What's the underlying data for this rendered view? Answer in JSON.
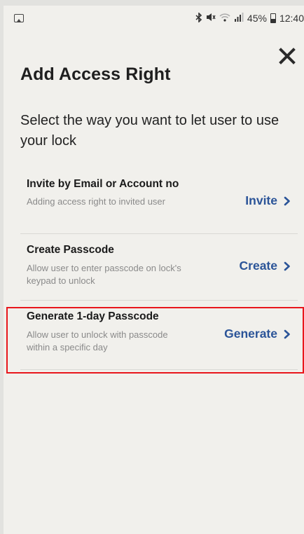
{
  "status_bar": {
    "left_icon": "image-icon",
    "icons": [
      "bluetooth-icon",
      "mute-icon",
      "wifi-icon",
      "signal-icon"
    ],
    "battery": "45%",
    "battery_level": 0.45,
    "time": "12:40"
  },
  "header": {
    "title": "Add Access Right",
    "close_icon": "close-icon"
  },
  "subtitle": "Select the way you want to let user to use your lock",
  "options": [
    {
      "title": "Invite by Email or Account no",
      "description": "Adding access right to invited user",
      "action": "Invite",
      "action_icon": "chevron-right-icon"
    },
    {
      "title": "Create Passcode",
      "description": "Allow user to enter passcode on lock's keypad to unlock",
      "action": "Create",
      "action_icon": "chevron-right-icon"
    },
    {
      "title": "Generate 1-day Passcode",
      "description": "Allow user to unlock with passcode within a specific day",
      "action": "Generate",
      "action_icon": "chevron-right-icon",
      "highlighted": true
    }
  ],
  "colors": {
    "background": "#f1f0ec",
    "accent": "#2b5498",
    "title_text": "#1f1f1f",
    "description_text": "#8a8a8a",
    "highlight_border": "#e8161c"
  }
}
